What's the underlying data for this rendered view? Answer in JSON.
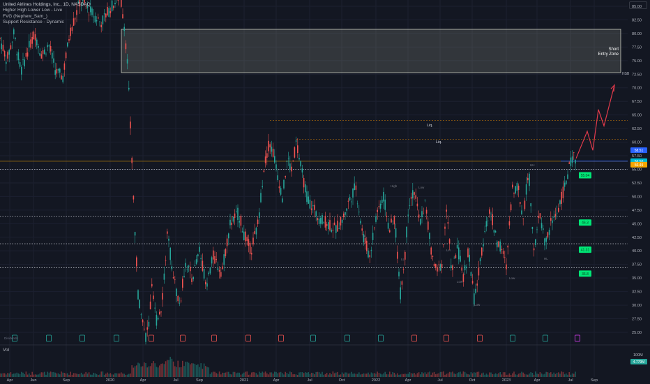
{
  "symbol": {
    "title": "United Airlines Holdings, Inc., 1D, NASDAQ",
    "indicators": [
      "Higher High Lower Low - Live",
      "FVG (Nephew_Sam_)",
      "Support Resistance - Dynamic"
    ]
  },
  "volume_label": "Vol",
  "volume_value": "4.779M",
  "volume_scale_label": "100M",
  "short_zone": {
    "line1": "Short",
    "line2": "Entry Zone"
  },
  "zone_tag": "HSB",
  "liq_labels": [
    "Liq.",
    "Liq."
  ],
  "price_tags": {
    "cyan_a": "58.51",
    "cyan_b": "56.50",
    "orange": "56.49"
  },
  "earnings_label": "Dividends",
  "colors": {
    "background": "#131722",
    "up": "#26a69a",
    "down": "#ef5350",
    "zone": "#a4a895",
    "support": "#00e676",
    "projection": "#e03a4b"
  },
  "chart_data": {
    "type": "candlestick",
    "title": "United Airlines Holdings, Inc., 1D, NASDAQ",
    "y_axis_ticks": [
      "85.00",
      "82.50",
      "80.00",
      "77.50",
      "75.00",
      "72.50",
      "70.00",
      "67.50",
      "65.00",
      "62.50",
      "60.00",
      "57.50",
      "55.00",
      "52.50",
      "50.00",
      "47.50",
      "45.00",
      "42.50",
      "40.00",
      "37.50",
      "35.00",
      "32.50",
      "30.00",
      "27.50",
      "25.00"
    ],
    "ylim": [
      23.5,
      87
    ],
    "x_axis_ticks": [
      "Apr",
      "Jun",
      "Sep",
      "2020",
      "Apr",
      "Jul",
      "Sep",
      "2021",
      "Apr",
      "Jul",
      "Oct",
      "2022",
      "Apr",
      "Jul",
      "Oct",
      "2023",
      "Apr",
      "Jul",
      "Sep"
    ],
    "short_entry_zone": [
      74.5,
      83
    ],
    "liquidity_levels": [
      64.0,
      60.5
    ],
    "current_price": 56.49,
    "support_levels": [
      {
        "price": 55.0,
        "label": "55.04"
      },
      {
        "price": 46.3,
        "label": "46.3"
      },
      {
        "price": 41.3,
        "label": "41.31"
      },
      {
        "price": 36.9,
        "label": "36.8"
      }
    ],
    "projection_path": [
      57.0,
      62.0,
      58.5,
      66.0,
      63.0,
      70.5
    ],
    "swing_labels": [
      "High",
      "Low",
      "HL",
      "LL",
      "LH",
      "HH"
    ],
    "volume_scale": "100M",
    "last_volume": "4.779M"
  }
}
